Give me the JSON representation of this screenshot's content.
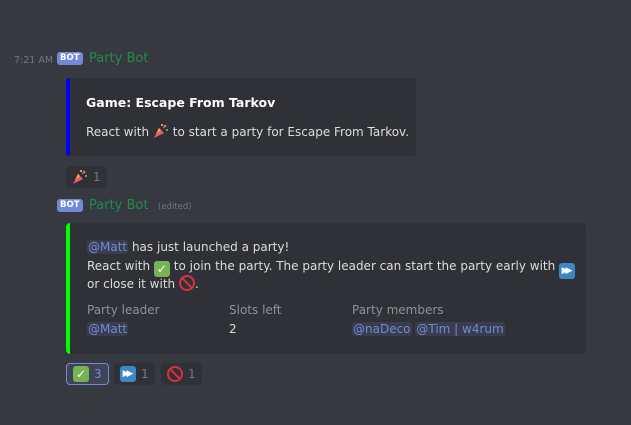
{
  "messages": [
    {
      "timestamp": "7:21 AM",
      "bot_tag": "BOT",
      "author": "Party Bot",
      "embed": {
        "border_color": "#0000ff",
        "title": "Game: Escape From Tarkov",
        "description_before": "React with",
        "description_emoji": "party-popper-icon",
        "description_after": "to start a party for Escape From Tarkov."
      },
      "reactions": [
        {
          "emoji": "party-popper-icon",
          "count": "1",
          "selected": false
        }
      ]
    },
    {
      "bot_tag": "BOT",
      "author": "Party Bot",
      "edited_label": "(edited)",
      "embed": {
        "border_color": "#00ff00",
        "line1_mention": "@Matt",
        "line1_text": "has just launched a party!",
        "line2_before": "React with",
        "line2_emoji": "white-check-mark-icon",
        "line2_after": "to join the party. The party leader can start the party early with",
        "line2_emoji2": "fast-forward-icon",
        "line3_before": "or close it with",
        "line3_emoji": "no-entry-sign-icon",
        "line3_after": ".",
        "fields": [
          {
            "name": "Party leader",
            "values": [
              "@Matt"
            ],
            "mention": true
          },
          {
            "name": "Slots left",
            "values": [
              "2"
            ],
            "mention": false
          },
          {
            "name": "Party members",
            "values": [
              "@naDeco",
              "@Tim | w4rum"
            ],
            "mention": true
          }
        ]
      },
      "reactions": [
        {
          "emoji": "white-check-mark-icon",
          "count": "3",
          "selected": true
        },
        {
          "emoji": "fast-forward-icon",
          "count": "1",
          "selected": false
        },
        {
          "emoji": "no-entry-sign-icon",
          "count": "1",
          "selected": false
        }
      ]
    }
  ],
  "colors": {
    "background": "#36393f",
    "embed_background": "#2f3136",
    "author": "#1f8b4c",
    "mention": "#7289da",
    "bot_tag": "#7289da"
  }
}
